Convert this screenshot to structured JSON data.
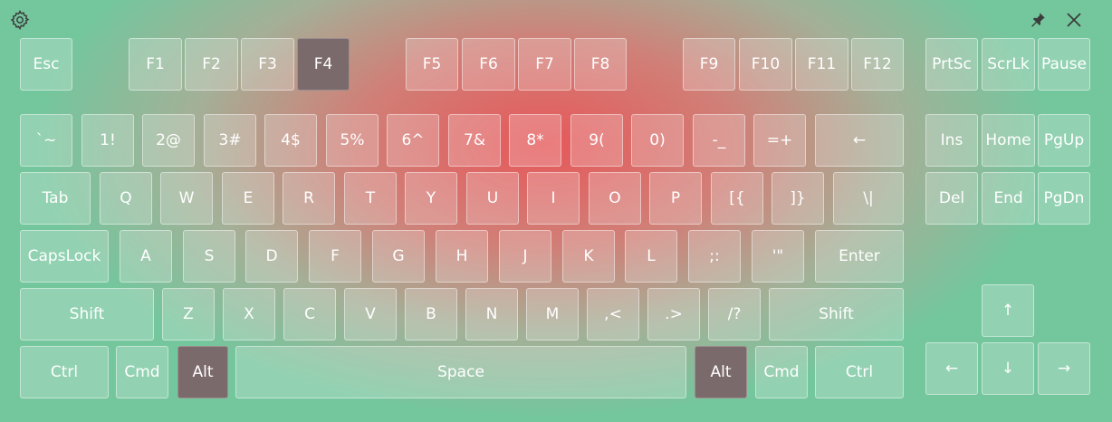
{
  "toolbar": {
    "settings_icon": "gear-icon",
    "pin_icon": "pin-icon",
    "close_icon": "close-icon"
  },
  "colors": {
    "key_fill": "rgba(255,255,255,0.22)",
    "key_pressed": "#7b6a6b",
    "background_edge": "#74c69d",
    "background_center": "#ec5256"
  },
  "keyboard": {
    "pressed_keys": [
      "F4",
      "Alt",
      "Alt"
    ],
    "keys": {
      "esc": "Esc",
      "f1": "F1",
      "f2": "F2",
      "f3": "F3",
      "f4": "F4",
      "f5": "F5",
      "f6": "F6",
      "f7": "F7",
      "f8": "F8",
      "f9": "F9",
      "f10": "F10",
      "f11": "F11",
      "f12": "F12",
      "prtsc": "PrtSc",
      "scrlk": "ScrLk",
      "pause": "Pause",
      "backtick": "`~",
      "d1": "1!",
      "d2": "2@",
      "d3": "3#",
      "d4": "4$",
      "d5": "5%",
      "d6": "6^",
      "d7": "7&",
      "d8": "8*",
      "d9": "9(",
      "d0": "0)",
      "minus": "-_",
      "equals": "=+",
      "backspace": "←",
      "ins": "Ins",
      "home": "Home",
      "pgup": "PgUp",
      "tab": "Tab",
      "q": "Q",
      "w": "W",
      "e": "E",
      "r": "R",
      "t": "T",
      "y": "Y",
      "u": "U",
      "i": "I",
      "o": "O",
      "p": "P",
      "lbracket": "[{",
      "rbracket": "]}",
      "backslash": "\\|",
      "del": "Del",
      "end": "End",
      "pgdn": "PgDn",
      "capslock": "CapsLock",
      "a": "A",
      "s": "S",
      "d": "D",
      "f": "F",
      "g": "G",
      "h": "H",
      "j": "J",
      "k": "K",
      "l": "L",
      "semicolon": ";:",
      "quote": "'\"",
      "enter": "Enter",
      "lshift": "Shift",
      "z": "Z",
      "x": "X",
      "c": "C",
      "v": "V",
      "b": "B",
      "n": "N",
      "m": "M",
      "comma": ",<",
      "period": ".>",
      "slash": "/?",
      "rshift": "Shift",
      "up": "↑",
      "lctrl": "Ctrl",
      "lcmd": "Cmd",
      "lalt": "Alt",
      "space": "Space",
      "ralt": "Alt",
      "rcmd": "Cmd",
      "rctrl": "Ctrl",
      "left": "←",
      "down": "↓",
      "right": "→"
    }
  }
}
